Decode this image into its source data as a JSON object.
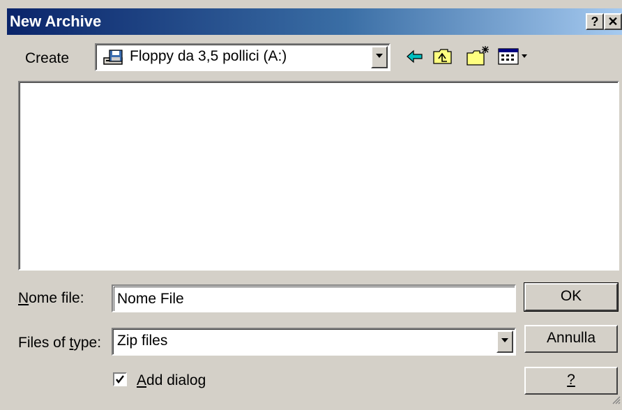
{
  "window": {
    "title": "New Archive"
  },
  "titlebar": {
    "help_label": "?",
    "close_label": "✕"
  },
  "location": {
    "label": "Create",
    "selected": "Floppy da 3,5 pollici (A:)",
    "selected_icon": "floppy-drive-icon"
  },
  "toolbar": [
    {
      "name": "back-icon"
    },
    {
      "name": "up-folder-icon"
    },
    {
      "name": "new-folder-icon"
    },
    {
      "name": "view-menu-icon"
    }
  ],
  "filename": {
    "label_first": "N",
    "label_rest": "ome file:",
    "value": "Nome File"
  },
  "filetype": {
    "label_pre": "Files of ",
    "label_key": "t",
    "label_post": "ype:",
    "selected": "Zip files"
  },
  "add_dialog": {
    "checked": true,
    "label_key": "A",
    "label_rest": "dd dialog"
  },
  "buttons": {
    "ok": "OK",
    "cancel": "Annulla",
    "help": "?"
  },
  "colors": {
    "face": "#d4d0c8",
    "title_start": "#0a246a",
    "title_end": "#a6caf0"
  }
}
